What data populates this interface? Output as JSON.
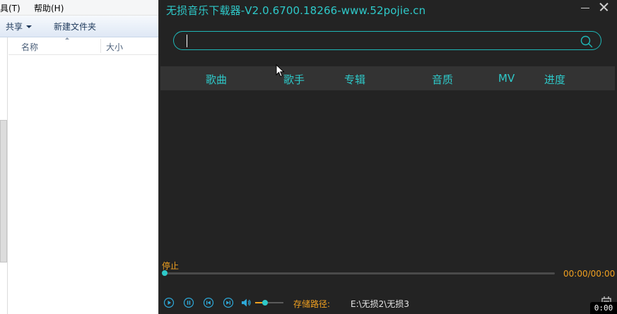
{
  "explorer": {
    "menu": {
      "tools": "工具(T)",
      "help": "帮助(H)"
    },
    "toolbar": {
      "share": "共享",
      "new_folder": "新建文件夹"
    },
    "columns": {
      "name": "名称",
      "size": "大小"
    }
  },
  "app": {
    "title": "无损音乐下载器-V2.0.6700.18266-www.52pojie.cn",
    "search": {
      "value": "",
      "placeholder": ""
    },
    "columns": [
      "歌曲",
      "歌手",
      "专辑",
      "音质",
      "MV",
      "进度"
    ],
    "status": "停止",
    "time": "00:00/00:00",
    "progress": 0,
    "volume": 0.35,
    "save_label": "存储路径:",
    "save_path": "E:\\无损2\\无损3",
    "colors": {
      "accent": "#2ec9c9",
      "orange": "#f0a020",
      "background": "#232323",
      "header": "#333333"
    }
  },
  "overlay": {
    "timestamp": "0:00"
  }
}
